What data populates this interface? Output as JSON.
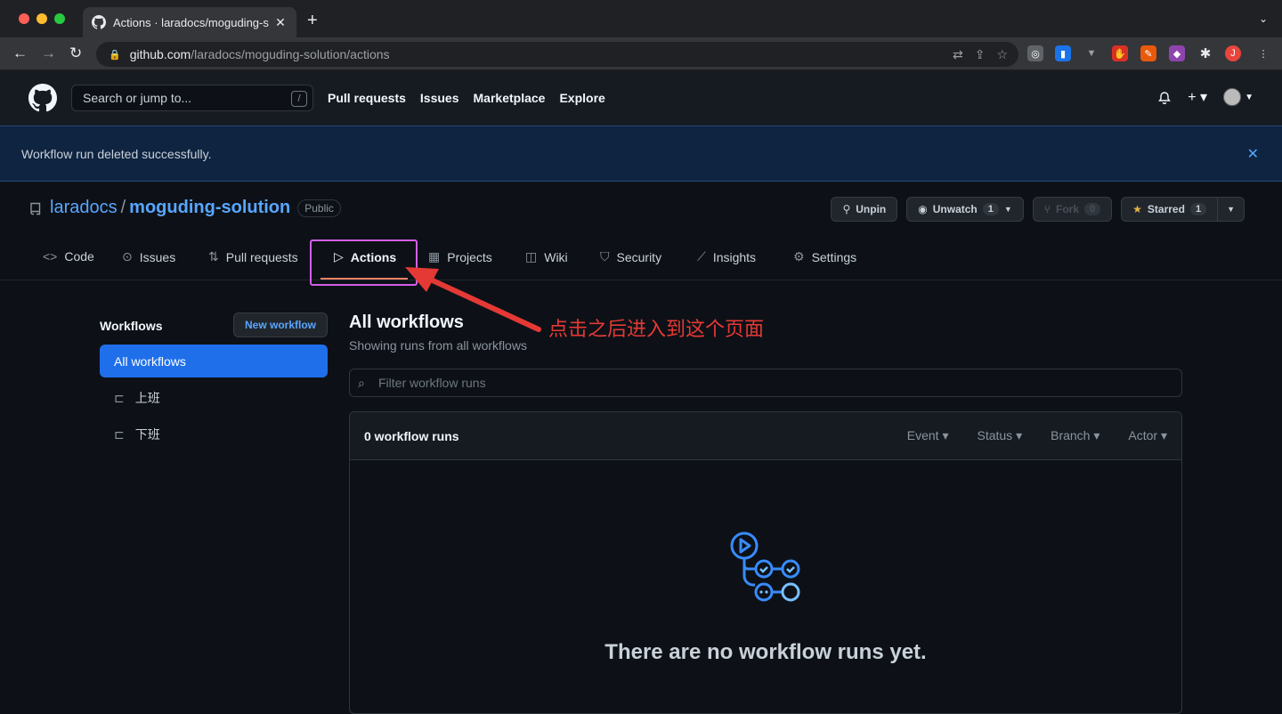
{
  "browser": {
    "tab_title": "Actions · laradocs/moguding-s",
    "tab_close": "✕",
    "new_tab": "+",
    "url_host": "github.com",
    "url_path": "/laradocs/moguding-solution/actions",
    "profile_initial": "J"
  },
  "header": {
    "search_placeholder": "Search or jump to...",
    "search_shortcut": "/",
    "nav": [
      "Pull requests",
      "Issues",
      "Marketplace",
      "Explore"
    ]
  },
  "flash": {
    "message": "Workflow run deleted successfully."
  },
  "repo": {
    "owner": "laradocs",
    "separator": "/",
    "name": "moguding-solution",
    "visibility": "Public",
    "unpin_label": "Unpin",
    "unwatch_label": "Unwatch",
    "unwatch_count": "1",
    "fork_label": "Fork",
    "fork_count": "0",
    "starred_label": "Starred",
    "starred_count": "1"
  },
  "repo_nav": [
    {
      "label": "Code",
      "icon": "code-icon"
    },
    {
      "label": "Issues",
      "icon": "issue-icon"
    },
    {
      "label": "Pull requests",
      "icon": "pull-request-icon"
    },
    {
      "label": "Actions",
      "icon": "play-icon",
      "active": true
    },
    {
      "label": "Projects",
      "icon": "table-icon"
    },
    {
      "label": "Wiki",
      "icon": "book-icon"
    },
    {
      "label": "Security",
      "icon": "shield-icon"
    },
    {
      "label": "Insights",
      "icon": "graph-icon"
    },
    {
      "label": "Settings",
      "icon": "gear-icon"
    }
  ],
  "sidebar": {
    "title": "Workflows",
    "new_workflow": "New workflow",
    "all_workflows": "All workflows",
    "workflows": [
      "上班",
      "下班"
    ]
  },
  "main": {
    "title": "All workflows",
    "subtitle": "Showing runs from all workflows",
    "filter_placeholder": "Filter workflow runs",
    "run_count": "0 workflow runs",
    "filters": [
      "Event",
      "Status",
      "Branch",
      "Actor"
    ],
    "empty_message": "There are no workflow runs yet."
  },
  "annotation": {
    "text": "点击之后进入到这个页面"
  },
  "colors": {
    "accent": "#1f6feb",
    "link": "#58a6ff",
    "highlight": "#d45ee8",
    "annotation": "#e53935"
  }
}
